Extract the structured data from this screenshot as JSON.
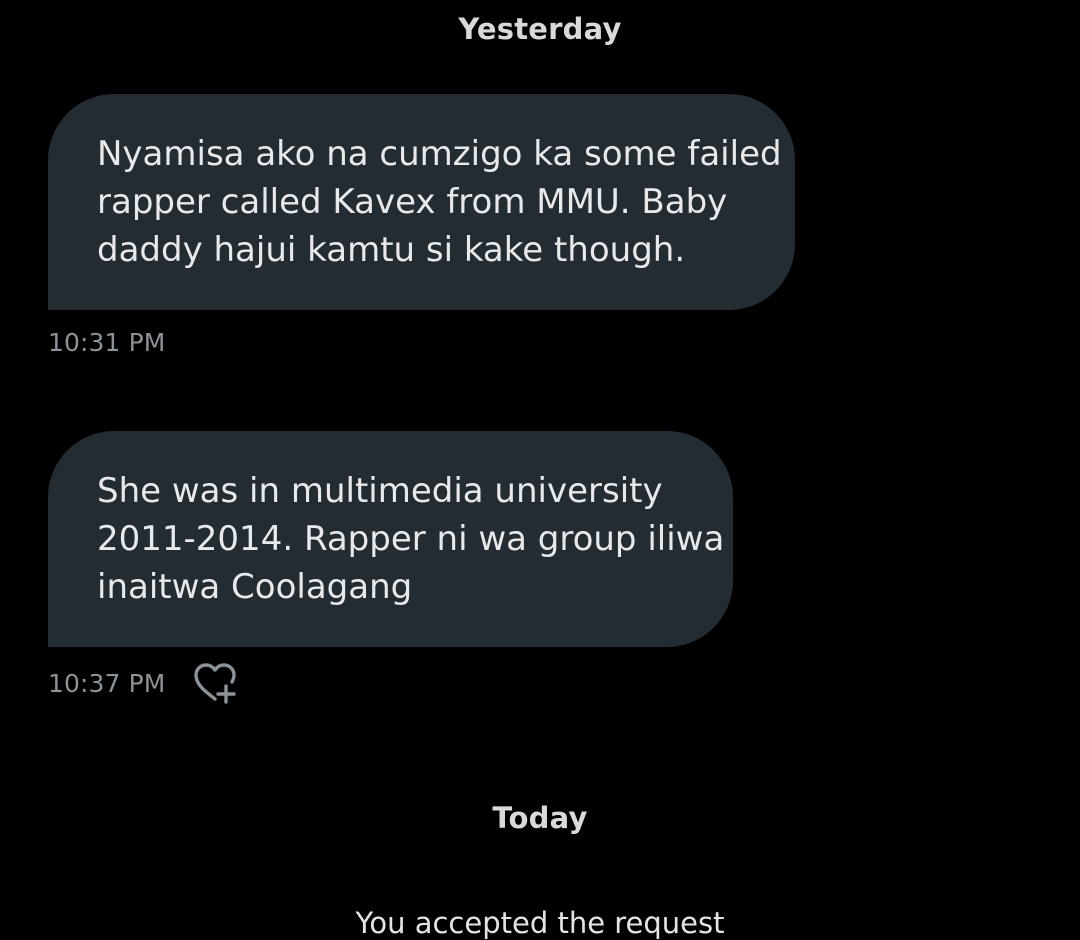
{
  "thread": {
    "sections": [
      {
        "date_label": "Yesterday",
        "messages": [
          {
            "lines": [
              "Nyamisa ako na cumzigo ka some failed",
              "rapper called Kavex from MMU. Baby",
              "daddy hajui kamtu si kake though."
            ],
            "time": "10:31 PM"
          },
          {
            "lines": [
              "She was in multimedia university",
              "2011-2014. Rapper ni wa group iliwa",
              "inaitwa Coolagang"
            ],
            "time": "10:37 PM",
            "reaction_icon": "heart-plus-icon"
          }
        ]
      },
      {
        "date_label": "Today",
        "system_message": "You accepted the request"
      }
    ]
  },
  "colors": {
    "background": "#000000",
    "bubble": "#232b33",
    "message_text": "#e7e9ea",
    "timestamp": "#8b9298",
    "date_label": "#d9d9d9"
  }
}
